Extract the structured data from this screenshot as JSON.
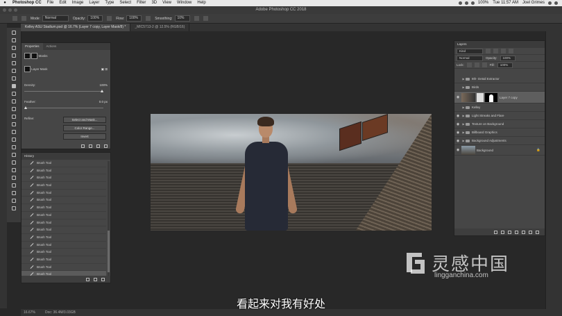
{
  "menubar": {
    "app_name": "Photoshop CC",
    "items": [
      "File",
      "Edit",
      "Image",
      "Layer",
      "Type",
      "Select",
      "Filter",
      "3D",
      "View",
      "Window",
      "Help"
    ],
    "battery": "100%",
    "clock": "Tue 11:57 AM",
    "user": "Joel Grimes"
  },
  "window": {
    "title": "Adobe Photoshop CC 2018"
  },
  "options": {
    "mode_label": "Mode:",
    "mode_value": "Normal",
    "opacity_label": "Opacity:",
    "opacity_value": "100%",
    "flow_label": "Flow:",
    "flow_value": "100%",
    "smoothing_label": "Smoothing:",
    "smoothing_value": "10%"
  },
  "tabs": [
    "Kelley ASU Stadium.psd @ 16.7% (Layer 7 copy, Layer Mask/8) *",
    "_MIC5713-2 @ 12.5% (RGB/16)"
  ],
  "properties": {
    "tab_properties": "Properties",
    "tab_actions": "Actions",
    "masks_label": "Masks",
    "layer_mask_label": "Layer Mask",
    "density_label": "Density:",
    "density_value": "100%",
    "feather_label": "Feather:",
    "feather_value": "0.0 px",
    "refine_label": "Refine:",
    "btn_select_mask": "Select and Mask...",
    "btn_color_range": "Color Range...",
    "btn_invert": "Invert"
  },
  "history": {
    "title": "History",
    "items": [
      "Brush Tool",
      "Brush Tool",
      "Brush Tool",
      "Brush Tool",
      "Brush Tool",
      "Brush Tool",
      "Brush Tool",
      "Brush Tool",
      "Brush Tool",
      "Brush Tool",
      "Brush Tool",
      "Brush Tool",
      "Brush Tool",
      "Brush Tool",
      "Brush Tool",
      "Brush Tool"
    ],
    "selected_index": 15
  },
  "layers": {
    "title": "Layers",
    "filter_kind": "Kind",
    "blend_mode": "Normal",
    "opacity_label": "Opacity:",
    "opacity_value": "100%",
    "lock_label": "Lock:",
    "fill_label": "Fill:",
    "fill_value": "100%",
    "items": [
      {
        "name": "8th- Detail Extractor",
        "type": "group",
        "visible": false
      },
      {
        "name": "Birds",
        "type": "group",
        "visible": false
      },
      {
        "name": "Layer 7 copy",
        "type": "layer-mask",
        "visible": true,
        "selected": true
      },
      {
        "name": "Kelley",
        "type": "group",
        "visible": false
      },
      {
        "name": "Light Streaks and Flare",
        "type": "group",
        "visible": true
      },
      {
        "name": "Texture on Background",
        "type": "group",
        "visible": true
      },
      {
        "name": "Billboard Graphics",
        "type": "group",
        "visible": true
      },
      {
        "name": "Background Adjustments",
        "type": "group",
        "visible": true
      },
      {
        "name": "Background",
        "type": "background",
        "visible": true
      }
    ]
  },
  "status": {
    "zoom": "16.67%",
    "doc": "Doc: 36.4M/3.03GB"
  },
  "subtitle": "看起来对我有好处",
  "watermark": {
    "cn": "灵感中国",
    "en": "lingganchina.com"
  },
  "colors": {
    "accent": "#ff9a1a",
    "panel": "#464646",
    "app_bg": "#282828"
  }
}
